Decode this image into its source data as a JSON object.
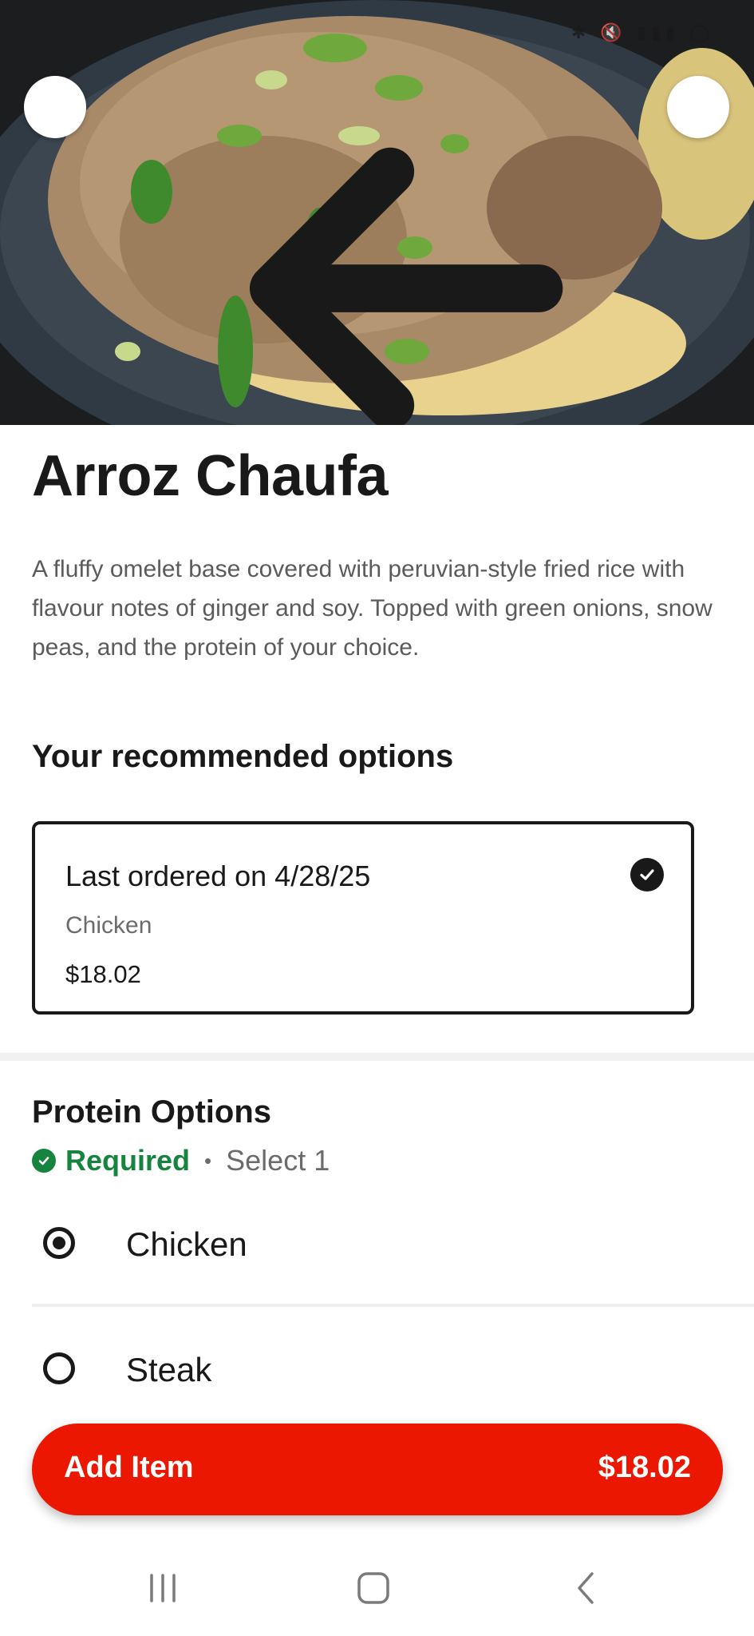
{
  "header": {
    "back_icon": "arrow-left-icon",
    "share_icon": "share-icon"
  },
  "item": {
    "title": "Arroz Chaufa",
    "description": "A fluffy omelet base covered with peruvian-style fried rice with flavour notes of ginger and soy. Topped with green onions, snow peas, and the protein of your choice."
  },
  "recommended": {
    "heading": "Your recommended options",
    "card": {
      "title": "Last ordered on 4/28/25",
      "option": "Chicken",
      "price": "$18.02",
      "selected": true
    }
  },
  "protein": {
    "heading": "Protein Options",
    "required_label": "Required",
    "separator": "•",
    "select_label": "Select 1",
    "options": [
      {
        "label": "Chicken",
        "selected": true
      },
      {
        "label": "Steak",
        "selected": false
      }
    ]
  },
  "cta": {
    "label": "Add Item",
    "price": "$18.02",
    "color": "#eb1700"
  },
  "colors": {
    "required_green": "#16843e",
    "text_primary": "#191919",
    "text_secondary": "#5b5b5b"
  }
}
